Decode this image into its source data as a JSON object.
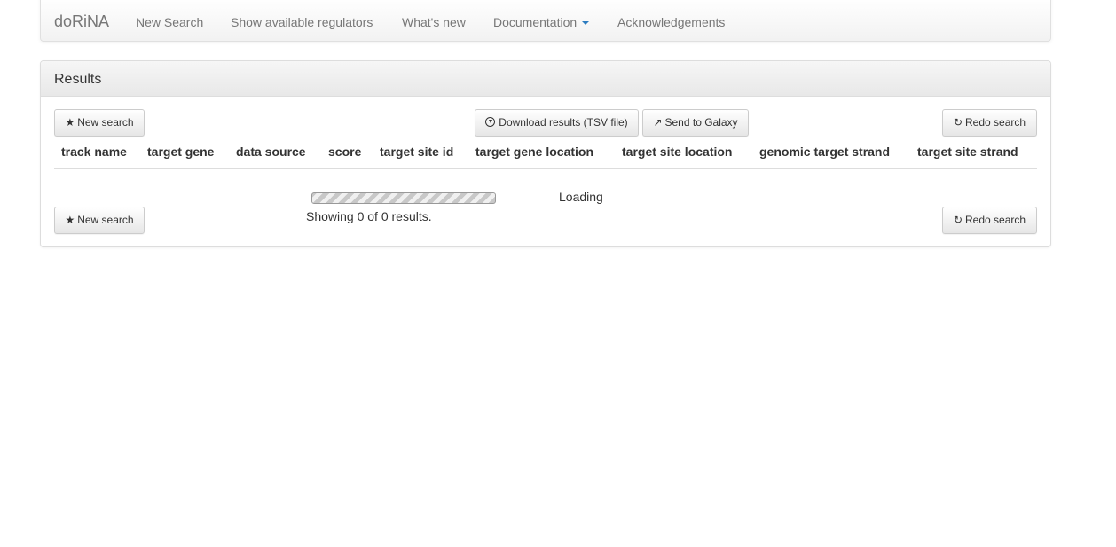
{
  "navbar": {
    "brand": "doRiNA",
    "items": [
      {
        "label": "New Search"
      },
      {
        "label": "Show available regulators"
      },
      {
        "label": "What's new"
      },
      {
        "label": "Documentation"
      },
      {
        "label": "Acknowledgements"
      }
    ]
  },
  "panel": {
    "title": "Results",
    "toolbar": {
      "new_search": "New search",
      "download": "Download results (TSV file)",
      "galaxy": "Send to Galaxy",
      "redo": "Redo search"
    },
    "table": {
      "columns": [
        "track name",
        "target gene",
        "data source",
        "score",
        "target site id",
        "target gene location",
        "target site location",
        "genomic target strand",
        "target site strand"
      ]
    },
    "status": {
      "loading": "Loading",
      "info": "Showing 0 of 0 results."
    },
    "icons": {
      "new_search": "star-icon",
      "download": "circle-arrow-down-icon",
      "galaxy": "share-icon",
      "redo": "refresh-icon"
    }
  }
}
